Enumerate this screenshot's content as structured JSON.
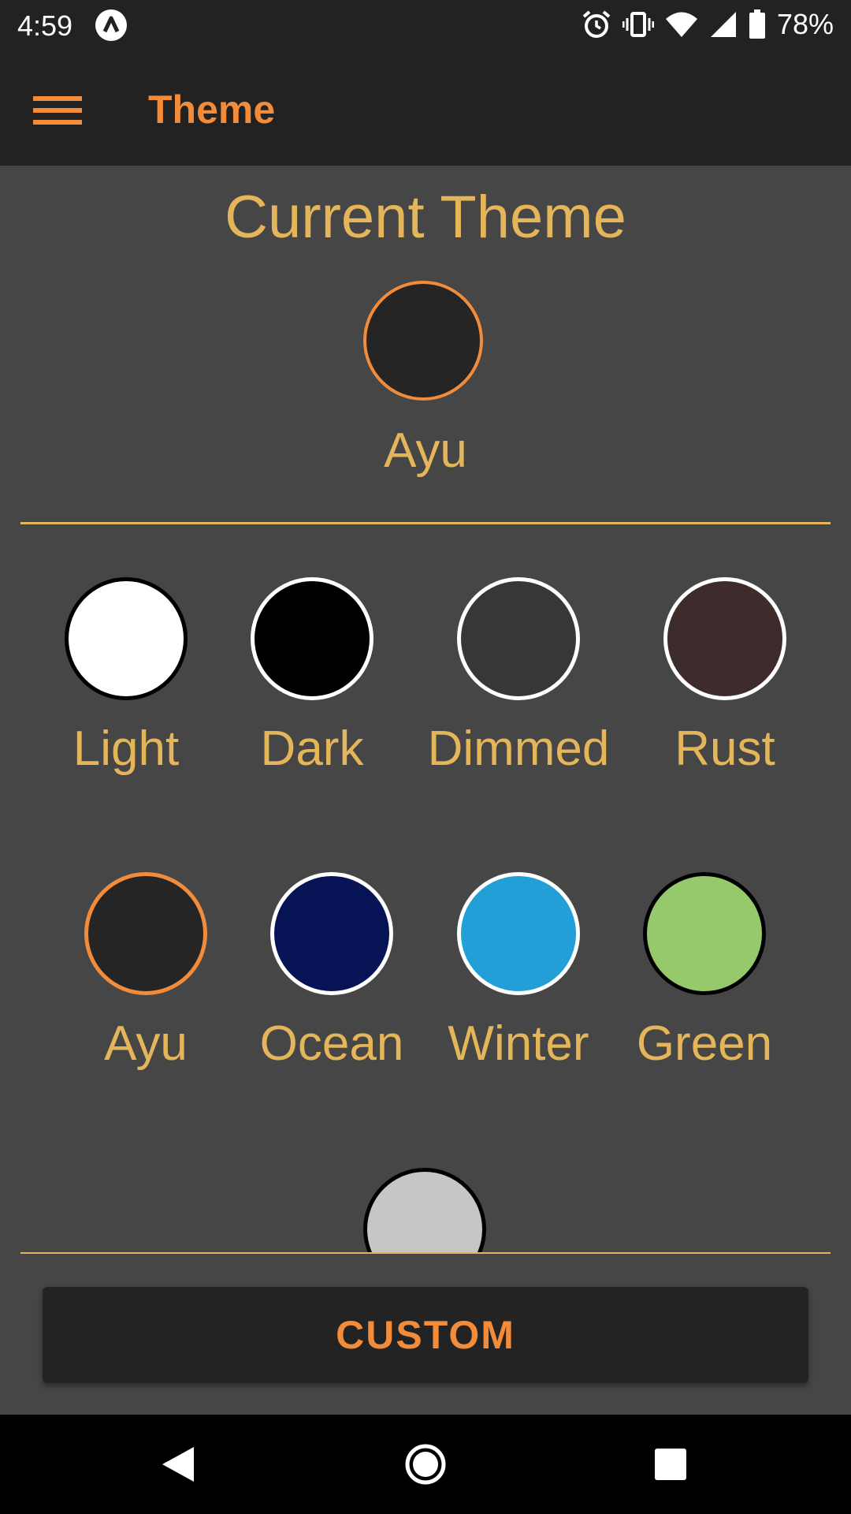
{
  "status_bar": {
    "time": "4:59",
    "battery": "78%"
  },
  "app_bar": {
    "title": "Theme"
  },
  "current": {
    "heading": "Current Theme",
    "name": "Ayu",
    "color": "#252525",
    "ring": "#f28c3a"
  },
  "themes": [
    {
      "name": "Light",
      "color": "#ffffff",
      "ring": "#000000"
    },
    {
      "name": "Dark",
      "color": "#000000",
      "ring": "#ffffff"
    },
    {
      "name": "Dimmed",
      "color": "#373737",
      "ring": "#ffffff"
    },
    {
      "name": "Rust",
      "color": "#3d2c2b",
      "ring": "#ffffff"
    },
    {
      "name": "Ayu",
      "color": "#252525",
      "ring": "#f28c3a"
    },
    {
      "name": "Ocean",
      "color": "#061456",
      "ring": "#ffffff"
    },
    {
      "name": "Winter",
      "color": "#229fd6",
      "ring": "#ffffff"
    },
    {
      "name": "Green",
      "color": "#95c96c",
      "ring": "#000000"
    }
  ],
  "extra_theme": {
    "color": "#c6c6c6",
    "ring": "#000000"
  },
  "custom_button": {
    "label": "CUSTOM"
  },
  "colors": {
    "accent": "#f28c3a",
    "text": "#e5b55a",
    "background": "#464646",
    "bar": "#222222"
  },
  "icons": {
    "status": [
      "alarm-icon",
      "vibrate-icon",
      "wifi-icon",
      "signal-icon",
      "battery-icon"
    ],
    "app_bar": "menu-icon",
    "nav": [
      "back-icon",
      "home-icon",
      "recents-icon"
    ]
  }
}
